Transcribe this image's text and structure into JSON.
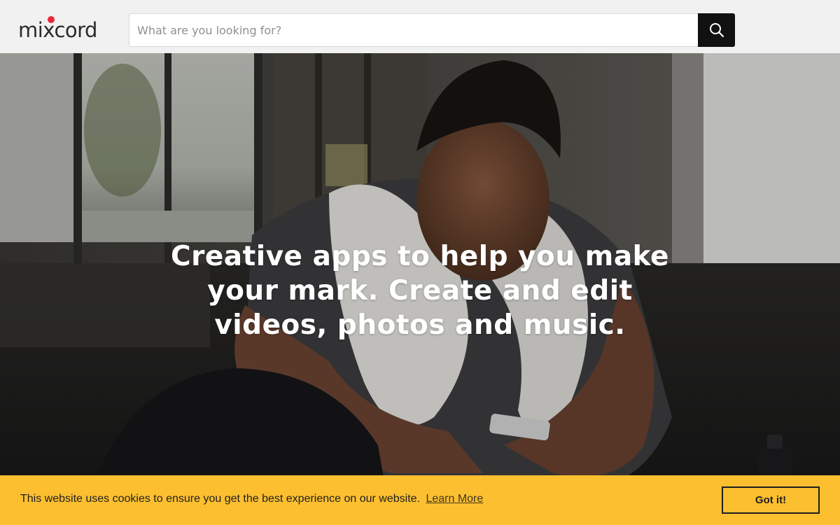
{
  "header": {
    "logo_text": "mixcord",
    "search": {
      "placeholder": "What are you looking for?",
      "value": "",
      "button_icon": "search-icon"
    }
  },
  "hero": {
    "title": "Creative apps to help you make your mark. Create and edit videos, photos and music."
  },
  "cookie_banner": {
    "message": "This website uses cookies to ensure you get the best experience on our website.",
    "learn_more": "Learn More",
    "dismiss": "Got it!"
  },
  "colors": {
    "header_bg": "#f1f1f1",
    "logo_dot": "#e8283a",
    "search_button": "#111111",
    "cookie_bg": "#fcbf30",
    "cookie_text": "#1f1f1f"
  }
}
